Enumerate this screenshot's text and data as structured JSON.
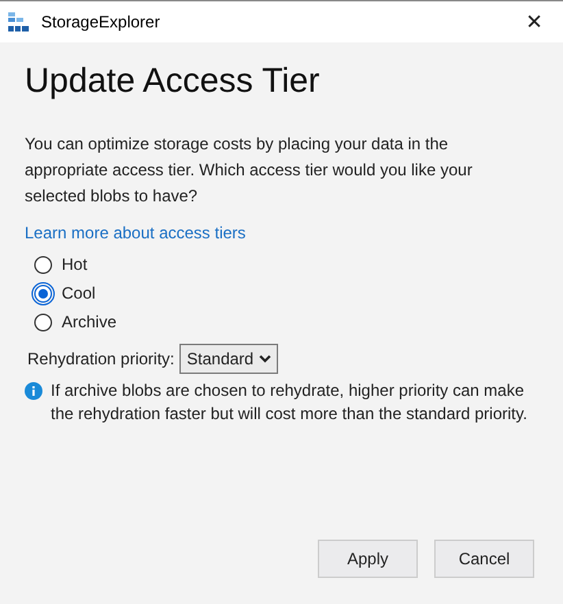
{
  "window": {
    "title": "StorageExplorer",
    "close": "✕"
  },
  "heading": "Update Access Tier",
  "description": "You can optimize storage costs by placing your data in the appropriate access tier. Which access tier would you like your selected blobs to have?",
  "link": "Learn more about access tiers",
  "tiers": [
    {
      "label": "Hot",
      "selected": false
    },
    {
      "label": "Cool",
      "selected": true
    },
    {
      "label": "Archive",
      "selected": false
    }
  ],
  "rehydration": {
    "label": "Rehydration priority:",
    "value": "Standard"
  },
  "info": "If archive blobs are chosen to rehydrate, higher priority can make the rehydration faster but will cost more than the standard priority.",
  "buttons": [
    "Apply",
    "Cancel"
  ]
}
